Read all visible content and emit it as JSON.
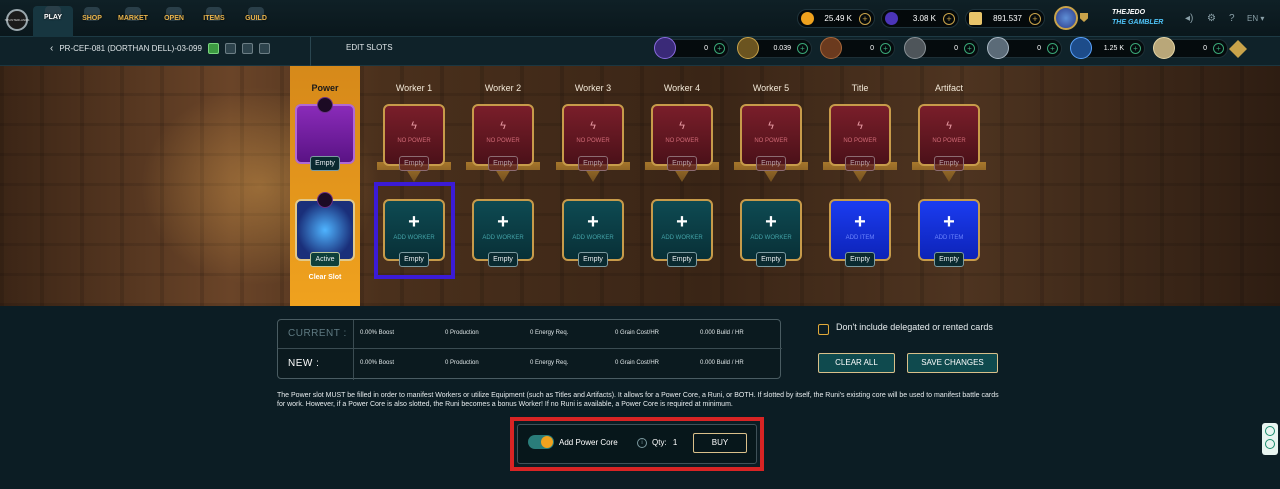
{
  "nav": {
    "logo": "SPLINTERLANDS",
    "items": [
      {
        "label": "PLAY",
        "icon": "crossed-swords-icon"
      },
      {
        "label": "SHOP",
        "icon": "chest-icon"
      },
      {
        "label": "MARKET",
        "icon": "market-icon"
      },
      {
        "label": "OPEN",
        "icon": "pack-icon"
      },
      {
        "label": "ITEMS",
        "icon": "cards-icon"
      },
      {
        "label": "GUILD",
        "icon": "guild-icon"
      }
    ],
    "currencies": [
      {
        "value": "25.49 K",
        "icon": "dec-coin-icon",
        "color": "#f0a21e"
      },
      {
        "value": "3.08 K",
        "icon": "sps-icon",
        "color": "#4b34b8"
      },
      {
        "value": "891.537",
        "icon": "credits-icon",
        "color": "#e9c46a"
      }
    ],
    "user": {
      "name": "THEJEDO",
      "title": "THE GAMBLER"
    },
    "language": "EN"
  },
  "subbar": {
    "plot": "PR-CEF-081 (DORTHAN DELL)-03-099",
    "section": "EDIT SLOTS",
    "resources": [
      {
        "value": "0",
        "icon": "power-core-icon"
      },
      {
        "value": "0.039",
        "icon": "grain-icon"
      },
      {
        "value": "0",
        "icon": "wood-icon"
      },
      {
        "value": "0",
        "icon": "stone-icon"
      },
      {
        "value": "0",
        "icon": "iron-icon"
      },
      {
        "value": "1.25 K",
        "icon": "research-icon"
      },
      {
        "value": "0",
        "icon": "spellbook-icon"
      }
    ]
  },
  "slots": {
    "power": {
      "label": "Power",
      "top_status": "Empty",
      "core_status": "Active",
      "clear": "Clear Slot"
    },
    "columns": [
      {
        "label": "Worker 1",
        "top_text": "NO POWER",
        "top_status": "Empty",
        "bottom_text": "ADD WORKER",
        "bottom_status": "Empty",
        "kind": "worker"
      },
      {
        "label": "Worker 2",
        "top_text": "NO POWER",
        "top_status": "Empty",
        "bottom_text": "ADD WORKER",
        "bottom_status": "Empty",
        "kind": "worker"
      },
      {
        "label": "Worker 3",
        "top_text": "NO POWER",
        "top_status": "Empty",
        "bottom_text": "ADD WORKER",
        "bottom_status": "Empty",
        "kind": "worker"
      },
      {
        "label": "Worker 4",
        "top_text": "NO POWER",
        "top_status": "Empty",
        "bottom_text": "ADD WORKER",
        "bottom_status": "Empty",
        "kind": "worker"
      },
      {
        "label": "Worker 5",
        "top_text": "NO POWER",
        "top_status": "Empty",
        "bottom_text": "ADD WORKER",
        "bottom_status": "Empty",
        "kind": "worker"
      },
      {
        "label": "Title",
        "top_text": "NO POWER",
        "top_status": "Empty",
        "bottom_text": "ADD ITEM",
        "bottom_status": "Empty",
        "kind": "item"
      },
      {
        "label": "Artifact",
        "top_text": "NO POWER",
        "top_status": "Empty",
        "bottom_text": "ADD ITEM",
        "bottom_status": "Empty",
        "kind": "item"
      }
    ]
  },
  "stats": {
    "current": {
      "label": "CURRENT :",
      "boost": "0.00% Boost",
      "production": "0 Production",
      "energy": "0 Energy Req.",
      "grain": "0 Grain Cost/HR",
      "build": "0.000 Build / HR"
    },
    "new": {
      "label": "NEW :",
      "boost": "0.00% Boost",
      "production": "0 Production",
      "energy": "0 Energy Req.",
      "grain": "0 Grain Cost/HR",
      "build": "0.000 Build / HR"
    }
  },
  "options": {
    "exclude_label": "Don't include delegated or rented cards",
    "clear_all": "CLEAR ALL",
    "save": "SAVE CHANGES"
  },
  "description": "The Power slot MUST be filled in order to manifest Workers or utilize Equipment (such as Titles and Artifacts). It allows for a Power Core, a Runi, or BOTH. If slotted by itself, the Runi's existing core will be used to manifest battle cards for work. However, if a Power Core is also slotted, the Runi becomes a bonus Worker! If no Runi is available, a Power Core is required at minimum.",
  "buy": {
    "toggle_label": "Add Power Core",
    "toggle_on": true,
    "qty_label": "Qty:",
    "qty_value": "1",
    "button": "BUY"
  }
}
